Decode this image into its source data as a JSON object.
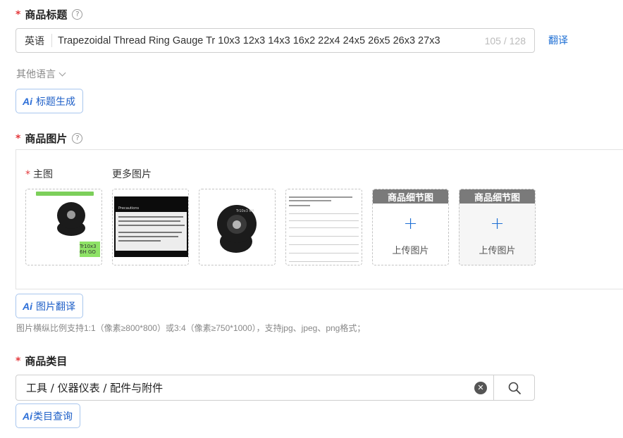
{
  "title_section": {
    "required_mark": "*",
    "label": "商品标题",
    "help_icon": "?",
    "lang_prefix": "英语",
    "value": "Trapezoidal Thread Ring Gauge Tr 10x3  12x3  14x3 16x2  22x4  24x5  26x5  26x3 27x3",
    "counter": "105 / 128",
    "translate_label": "翻译",
    "other_lang_label": "其他语言",
    "ai_button_label": "标题生成"
  },
  "image_section": {
    "required_mark": "*",
    "label": "商品图片",
    "help_icon": "?",
    "main_required_mark": "*",
    "main_label": "主图",
    "more_label": "更多图片",
    "main_tag": "Tr10x3 6H GO",
    "ring_mark": "Tr10x3 6H",
    "doc_heading": "Precautions",
    "detail_slots": [
      {
        "header": "商品细节图",
        "action": "上传图片"
      },
      {
        "header": "商品细节图",
        "action": "上传图片"
      }
    ],
    "ai_button_label": "图片翻译",
    "hint": "图片横纵比例支持1:1（像素≥800*800）或3:4（像素≥750*1000），支持jpg、jpeg、png格式；"
  },
  "category_section": {
    "required_mark": "*",
    "label": "商品类目",
    "value": "工具 / 仪器仪表 / 配件与附件",
    "ai_button_label": "类目查询"
  },
  "ai_mark": "Ai",
  "icons": {
    "help": "question-circle-icon",
    "chevron": "chevron-down-icon",
    "clear": "clear-circle-icon",
    "search": "search-icon",
    "plus": "plus-icon"
  },
  "colors": {
    "required": "#e4393c",
    "link": "#1e6fd4",
    "ai_border": "#a8c6ee",
    "detail_header": "#7a7a7a"
  }
}
